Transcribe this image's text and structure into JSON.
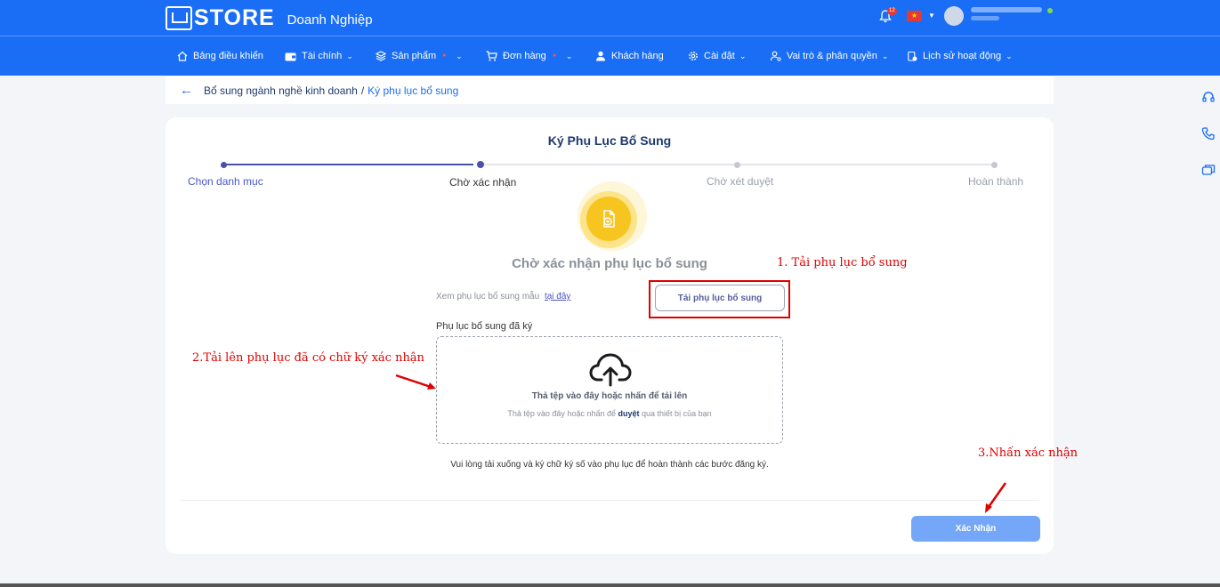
{
  "header": {
    "brand": "STORE",
    "subtitle": "Doanh Nghiệp",
    "notification_count": "12",
    "flag_icon": "vietnam-flag-icon",
    "brand_color": "#1a6ef5"
  },
  "nav": {
    "items": [
      {
        "label": "Bảng điều khiển",
        "icon": "home-icon"
      },
      {
        "label": "Tài chính",
        "icon": "wallet-icon"
      },
      {
        "label": "Sản phẩm",
        "icon": "layers-icon"
      },
      {
        "label": "Đơn hàng",
        "icon": "cart-icon"
      },
      {
        "label": "Khách hàng",
        "icon": "user-icon"
      },
      {
        "label": "Cài đặt",
        "icon": "gear-icon"
      },
      {
        "label": "Vai trò & phân quyền",
        "icon": "role-icon"
      },
      {
        "label": "Lịch sử hoạt động",
        "icon": "history-icon"
      }
    ]
  },
  "breadcrumb": {
    "parent": "Bổ sung ngành nghề kinh doanh",
    "separator": "/",
    "current": "Ký phụ lục bổ sung"
  },
  "card": {
    "title": "Ký Phụ Lục Bổ Sung",
    "steps": [
      {
        "label": "Chọn danh mục",
        "state": "done"
      },
      {
        "label": "Chờ xác nhận",
        "state": "current"
      },
      {
        "label": "Chờ xét duyệt",
        "state": "pending"
      },
      {
        "label": "Hoàn thành",
        "state": "pending"
      }
    ],
    "waiting_title": "Chờ xác nhận phụ lục bổ sung",
    "sample_text": "Xem phụ lục bổ sung mẫu",
    "sample_link": "tại đây",
    "download_button": "Tải phụ lục bổ sung",
    "signed_label": "Phụ lục bổ sung đã ký",
    "dropzone_title": "Thả tệp vào đây hoặc nhấn để tải lên",
    "dropzone_sub_before": "Thả tệp vào đây hoặc nhấn để",
    "dropzone_sub_link": "duyệt",
    "dropzone_sub_after": "qua thiết bị của bạn",
    "note": "Vui lòng tải xuống và ký chữ ký số vào phụ lục để hoàn thành các bước đăng ký.",
    "confirm_button": "Xác Nhận"
  },
  "annotations": {
    "step1": "1. Tải phụ lục bổ sung",
    "step2": "2.Tải lên phụ lục đã có chữ ký xác nhận",
    "step3": "3.Nhấn xác nhận",
    "color": "#e00000"
  }
}
